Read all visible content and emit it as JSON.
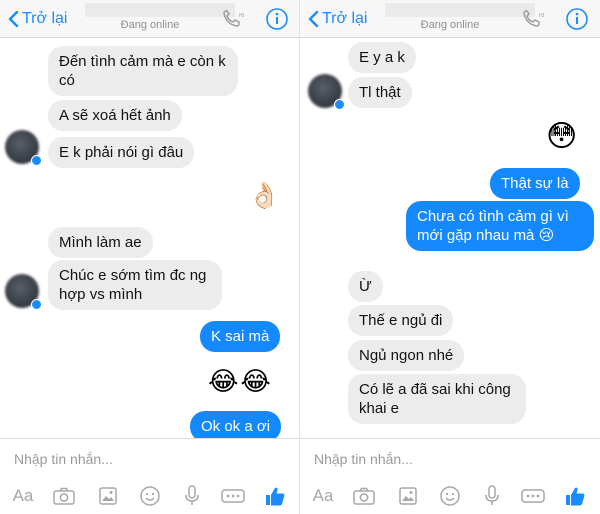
{
  "header": {
    "back_label": "Trở lại",
    "status": "Đang online"
  },
  "left": {
    "messages": {
      "m1": "Đến tình cảm mà e còn k có",
      "m2": "A sẽ xoá hết ảnh",
      "m3": "E k phải nói gì đâu",
      "m4": "Mình làm ae",
      "m5": "Chúc e sớm tìm đc ng hợp vs mình",
      "m6": "K sai mà",
      "m7": "Ok ok a ơi"
    },
    "emojis": {
      "e1": "👌🏻",
      "e2": "😂😂"
    }
  },
  "right": {
    "messages": {
      "m1": "E y a k",
      "m2": "Tl thật",
      "m3": "Thật sự là",
      "m4": "Chưa có tình cảm gì vì mới gặp nhau mà 😢",
      "m5": "Ừ",
      "m6": "Thế e ngủ đi",
      "m7": "Ngủ ngon nhé",
      "m8": "Có lẽ a đã sai khi công khai e"
    },
    "emojis": {
      "e1": "😳"
    }
  },
  "composer": {
    "placeholder": "Nhập tin nhắn...",
    "aa_label": "Aa"
  },
  "colors": {
    "accent": "#1a8cff",
    "outgoing_bubble": "#1389fd",
    "incoming_bubble": "#ececec"
  },
  "icons": [
    "chevron-left-icon",
    "phone-icon",
    "info-icon",
    "camera-icon",
    "gallery-icon",
    "emoji-icon",
    "microphone-icon",
    "more-icon",
    "like-icon"
  ]
}
